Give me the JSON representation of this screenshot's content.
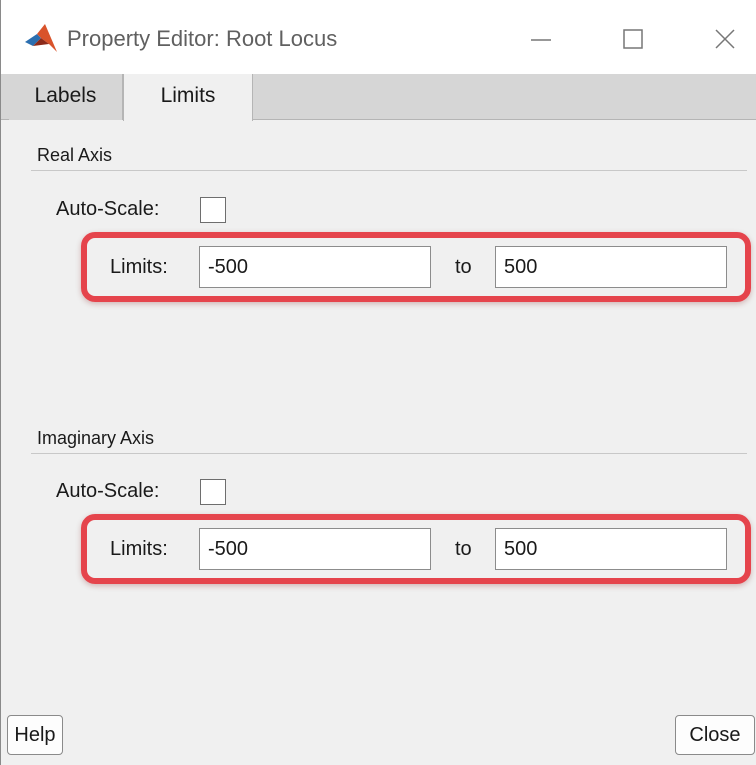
{
  "window": {
    "title": "Property Editor: Root Locus",
    "app_icon": "matlab-logo-icon",
    "controls": {
      "minimize_icon": "minimize-icon",
      "maximize_icon": "maximize-icon",
      "close_icon": "close-icon"
    }
  },
  "tabs": [
    {
      "label": "Labels",
      "selected": false
    },
    {
      "label": "Limits",
      "selected": true
    }
  ],
  "real_axis": {
    "title": "Real Axis",
    "auto_scale_label": "Auto-Scale:",
    "auto_scale_checked": false,
    "limits_label": "Limits:",
    "min_value": "-500",
    "to_label": "to",
    "max_value": "500"
  },
  "imaginary_axis": {
    "title": "Imaginary Axis",
    "auto_scale_label": "Auto-Scale:",
    "auto_scale_checked": false,
    "limits_label": "Limits:",
    "min_value": "-500",
    "to_label": "to",
    "max_value": "500"
  },
  "buttons": {
    "help": "Help",
    "close": "Close"
  },
  "colors": {
    "highlight": "#e5444c",
    "tab_active": "#f0f0f0",
    "tab_inactive": "#d6d6d6"
  }
}
